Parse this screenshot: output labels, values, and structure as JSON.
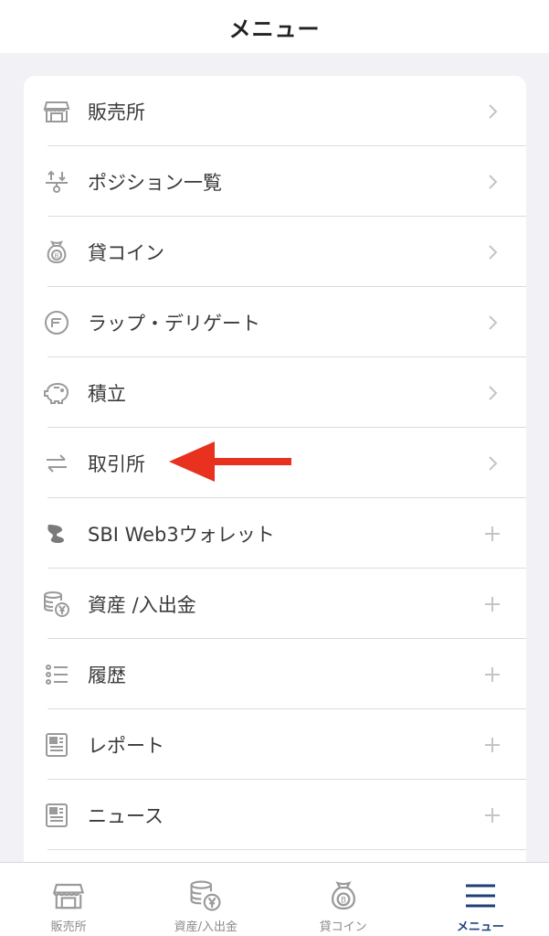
{
  "header": {
    "title": "メニュー"
  },
  "menu": {
    "items": [
      {
        "label": "販売所",
        "icon": "store-icon",
        "trail": "chevron-right"
      },
      {
        "label": "ポジション一覧",
        "icon": "position-icon",
        "trail": "chevron-right"
      },
      {
        "label": "貸コイン",
        "icon": "coin-bag-icon",
        "trail": "chevron-right"
      },
      {
        "label": "ラップ・デリゲート",
        "icon": "wrap-icon",
        "trail": "chevron-right"
      },
      {
        "label": "積立",
        "icon": "piggy-bank-icon",
        "trail": "chevron-right"
      },
      {
        "label": "取引所",
        "icon": "exchange-icon",
        "trail": "chevron-right"
      },
      {
        "label": "SBI Web3ウォレット",
        "icon": "wallet-logo-icon",
        "trail": "plus"
      },
      {
        "label": "資産 /入出金",
        "icon": "coin-stack-yen-icon",
        "trail": "plus"
      },
      {
        "label": "履歴",
        "icon": "list-icon",
        "trail": "plus"
      },
      {
        "label": "レポート",
        "icon": "report-icon",
        "trail": "plus"
      },
      {
        "label": "ニュース",
        "icon": "news-icon",
        "trail": "plus"
      }
    ]
  },
  "annotation": {
    "type": "red-arrow",
    "points_to": "取引所",
    "color": "#e8311f"
  },
  "tabbar": {
    "tabs": [
      {
        "label": "販売所",
        "icon": "store-icon",
        "active": false
      },
      {
        "label": "資産/入出金",
        "icon": "coin-stack-yen-icon",
        "active": false
      },
      {
        "label": "貸コイン",
        "icon": "coin-bag-icon",
        "active": false
      },
      {
        "label": "メニュー",
        "icon": "hamburger-menu-icon",
        "active": true
      }
    ]
  },
  "colors": {
    "background": "#f2f2f6",
    "card": "#ffffff",
    "icon_gray": "#9a9a9a",
    "active_tab": "#1f3f7a",
    "arrow": "#e8311f"
  }
}
